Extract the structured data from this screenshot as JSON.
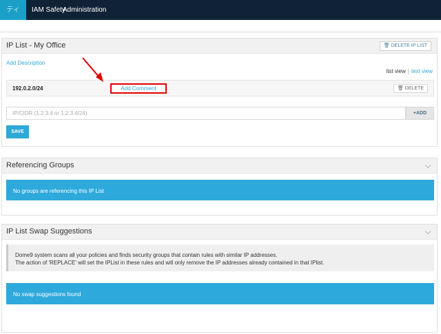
{
  "topnav": {
    "active_item": "ティ",
    "items": [
      "IAM Safety",
      "Administration"
    ]
  },
  "ip_list_panel": {
    "title": "IP List - My Office",
    "delete_list_label": "DELETE IP LIST",
    "add_description": "Add Description",
    "view_switch": {
      "list_view": "list view",
      "separator": "|",
      "text_view": "text view"
    },
    "entry": {
      "ip": "192.0.2.0/24",
      "add_comment": "Add Comment",
      "delete_label": "DELETE"
    },
    "input_placeholder": "IP/CIDR (1.2.3.4 or 1.2.3.4/24)",
    "add_label": "ADD",
    "save_label": "SAVE"
  },
  "referencing_groups_panel": {
    "title": "Referencing Groups",
    "message": "No groups are referencing this IP List"
  },
  "swap_panel": {
    "title": "IP List Swap Suggestions",
    "note_line1": "Dome9 system scans all your policies and finds security groups that contain rules with similar IP addresses.",
    "note_line2": "The action of 'REPLACE' will set the IPList in these rules and will only remove the IP addresses already contained in that IPlist.",
    "message": "No swap suggestions found"
  },
  "colors": {
    "nav_bg": "#0f2236",
    "accent": "#2ea8d6",
    "highlight": "#e00000"
  },
  "icons": [
    "trash-icon",
    "plus-icon",
    "chevron-down-icon",
    "annotation-arrow"
  ]
}
